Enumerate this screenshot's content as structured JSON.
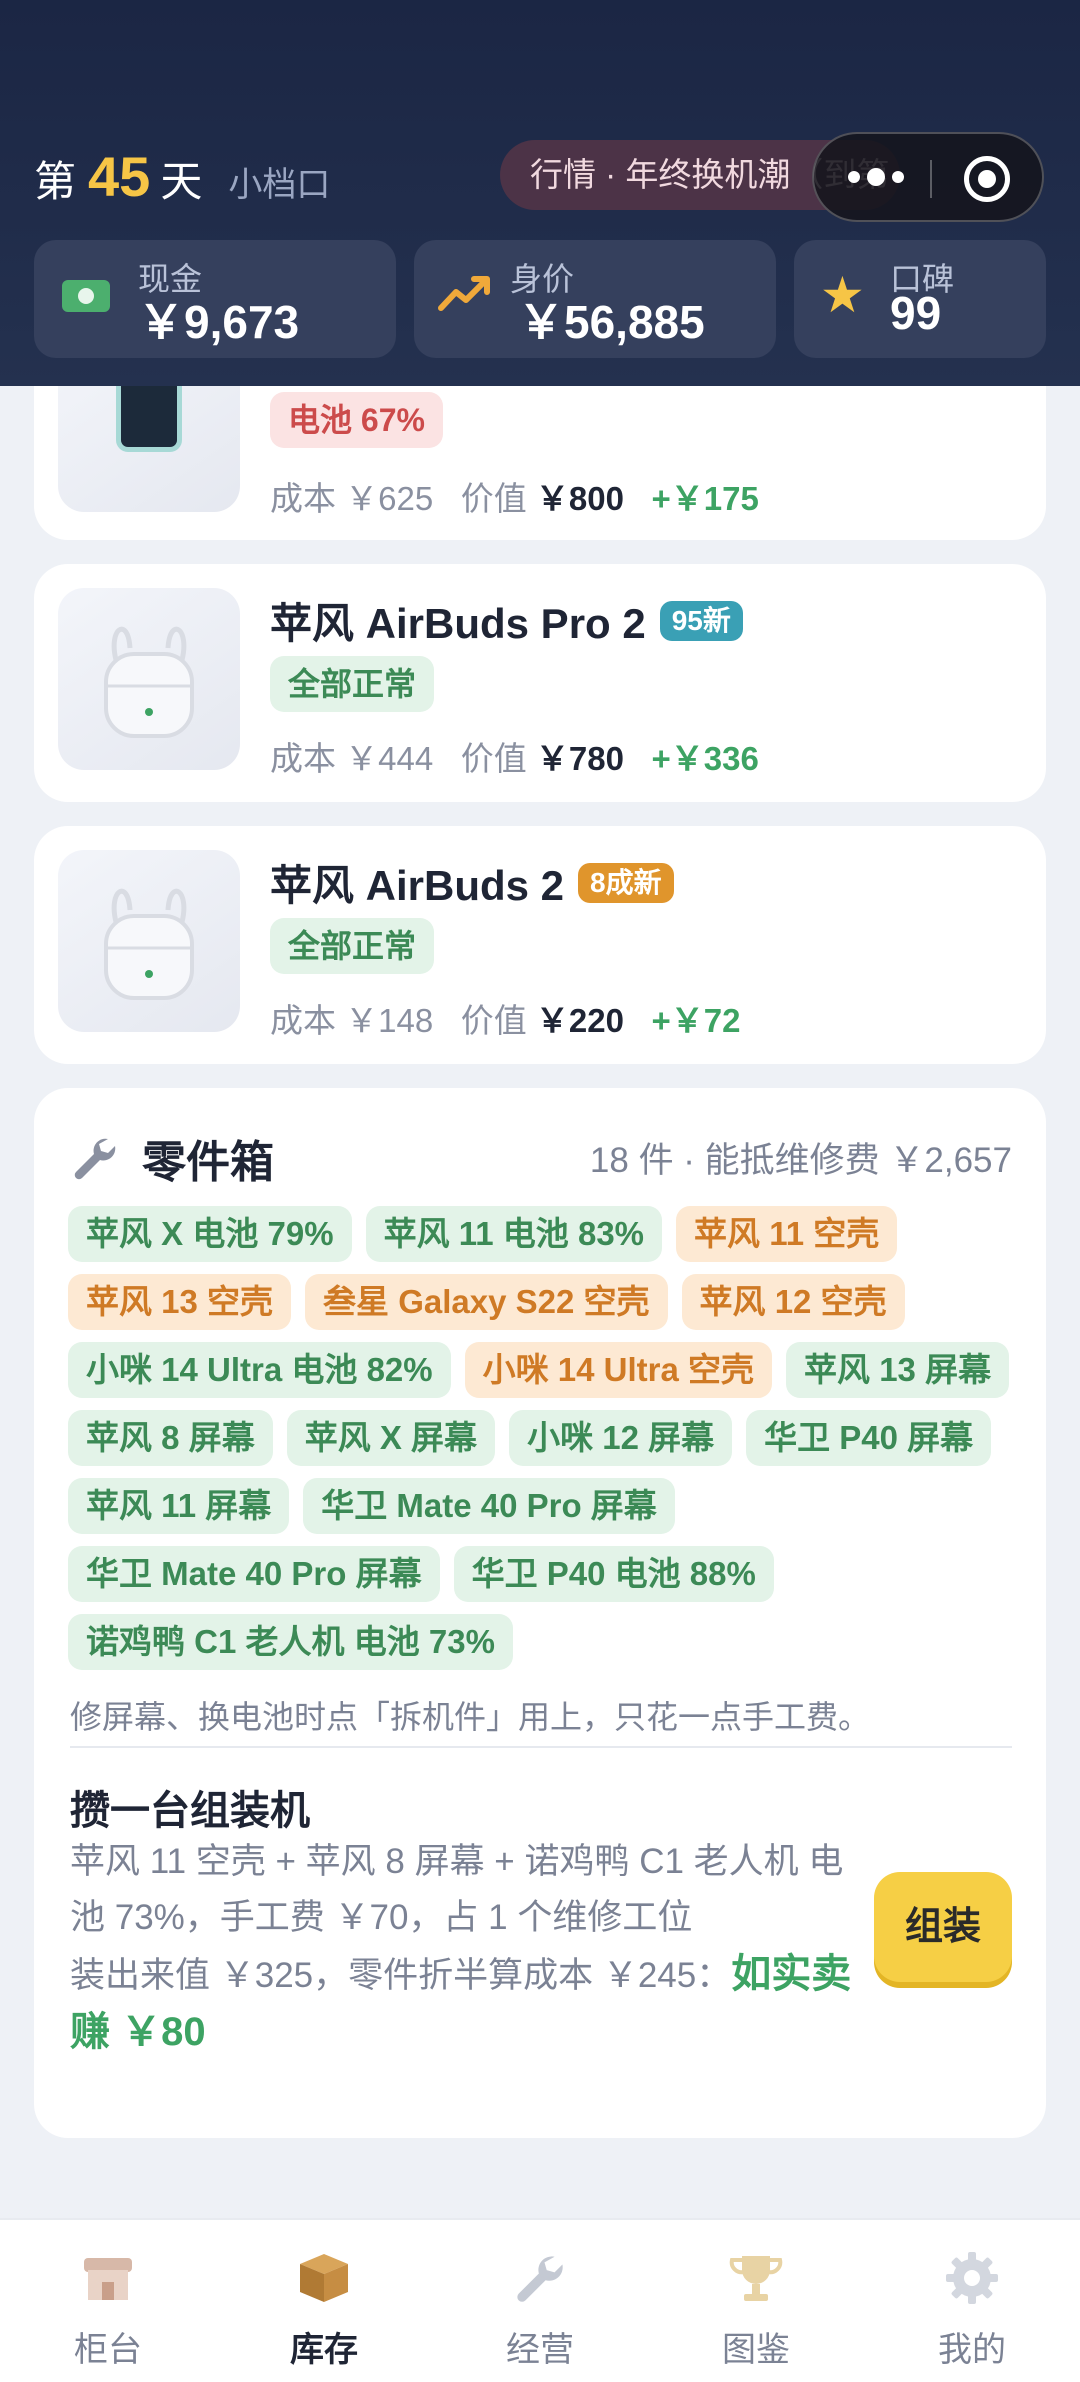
{
  "header": {
    "day_prefix": "第",
    "day_number": "45",
    "day_suffix": "天",
    "shop_name": "小档口",
    "market_text": "行情 · 年终换机潮（到第 47 天）",
    "stats": {
      "cash": {
        "label": "现金",
        "value": "￥9,673",
        "icon": "cash-icon"
      },
      "worth": {
        "label": "身价",
        "value": "￥56,885",
        "icon": "trend-up-icon"
      },
      "reputation": {
        "label": "口碑",
        "value": "99",
        "icon": "star-icon"
      }
    }
  },
  "inventory": [
    {
      "name": "",
      "badge": "",
      "status": "电池 67%",
      "cost_label": "成本",
      "cost": "￥625",
      "value_label": "价值",
      "value": "￥800",
      "profit": "+￥175"
    },
    {
      "name": "苹风 AirBuds Pro 2",
      "badge": "95新",
      "status": "全部正常",
      "cost_label": "成本",
      "cost": "￥444",
      "value_label": "价值",
      "value": "￥780",
      "profit": "+￥336"
    },
    {
      "name": "苹风 AirBuds 2",
      "badge": "8成新",
      "status": "全部正常",
      "cost_label": "成本",
      "cost": "￥148",
      "value_label": "价值",
      "value": "￥220",
      "profit": "+￥72"
    }
  ],
  "parts_box": {
    "title": "零件箱",
    "summary": "18 件 · 能抵维修费 ￥2,657",
    "tags": [
      "苹风 X 电池 79%",
      "苹风 11 电池 83%",
      "苹风 11 空壳",
      "苹风 13 空壳",
      "叁星 Galaxy S22 空壳",
      "苹风 12 空壳",
      "小咪 14 Ultra 电池 82%",
      "小咪 14 Ultra 空壳",
      "苹风 13 屏幕",
      "苹风 8 屏幕",
      "苹风 X 屏幕",
      "小咪 12 屏幕",
      "华卫 P40 屏幕",
      "苹风 11 屏幕",
      "华卫 Mate 40 Pro 屏幕",
      "华卫 Mate 40 Pro 屏幕",
      "华卫 P40 电池 88%",
      "诺鸡鸭 C1 老人机 电池 73%"
    ],
    "tip": "修屏幕、换电池时点「拆机件」用上，只花一点手工费。",
    "combo": {
      "title": "攒一台组装机",
      "desc": "苹风 11 空壳 + 苹风 8 屏幕 + 诺鸡鸭 C1 老人机 电池 73%，手工费 ￥70，占 1 个维修工位",
      "result": "装出来值 ￥325，零件折半算成本 ￥245：",
      "profit": "如实卖赚 ￥80",
      "button": "组装"
    }
  },
  "tabbar": [
    {
      "label": "柜台",
      "icon": "store-icon"
    },
    {
      "label": "库存",
      "icon": "box-icon",
      "active": true
    },
    {
      "label": "经营",
      "icon": "wrench-icon"
    },
    {
      "label": "图鉴",
      "icon": "trophy-icon"
    },
    {
      "label": "我的",
      "icon": "gear-icon"
    }
  ],
  "colors": {
    "header_bg": "#1b2644",
    "accent_gold": "#f6c546",
    "profit_green": "#3da363",
    "part_orange": "#cf7a25"
  }
}
